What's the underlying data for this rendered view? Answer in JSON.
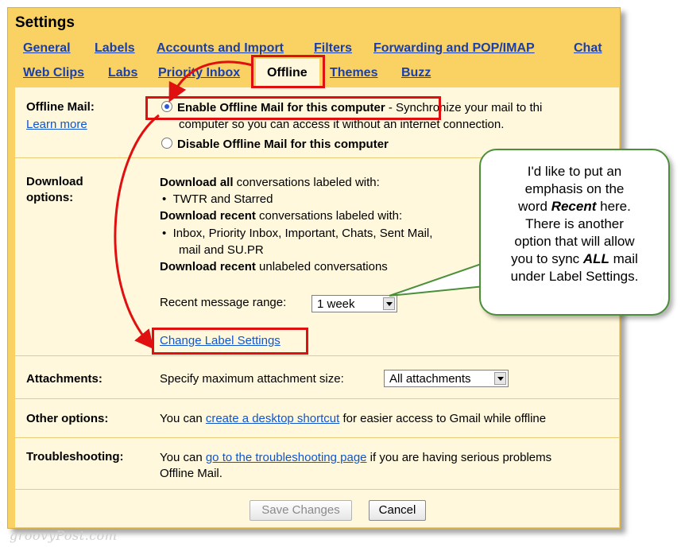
{
  "settings": {
    "title": "Settings",
    "tabs": [
      {
        "label": "General"
      },
      {
        "label": "Labels"
      },
      {
        "label": "Accounts and Import"
      },
      {
        "label": "Filters"
      },
      {
        "label": "Forwarding and POP/IMAP"
      },
      {
        "label": "Chat"
      },
      {
        "label": "Web Clips"
      },
      {
        "label": "Labs"
      },
      {
        "label": "Priority Inbox"
      },
      {
        "label": "Offline"
      },
      {
        "label": "Themes"
      },
      {
        "label": "Buzz"
      }
    ],
    "active_tab": "Offline"
  },
  "offline_mail": {
    "label": "Offline Mail:",
    "learn_more": "Learn more",
    "enable": {
      "label": "Enable Offline Mail for this computer",
      "desc_line1": " - Synchronize your mail to thi",
      "desc_line2": "computer so you can access it without an internet connection."
    },
    "disable_label": "Disable Offline Mail for this computer"
  },
  "download": {
    "label_line1": "Download",
    "label_line2": "options:",
    "all_bold": "Download all",
    "all_rest": " conversations labeled with:",
    "all_bullet": "TWTR and Starred",
    "recent_bold": "Download recent",
    "recent_rest": " conversations labeled with:",
    "recent_bullet_line1": "Inbox, Priority Inbox, Important, Chats, Sent Mail,",
    "recent_bullet_line2": "mail and SU.PR",
    "unlabeled_bold": "Download recent",
    "unlabeled_rest": " unlabeled conversations",
    "range_label": "Recent message range:",
    "range_value": "1 week",
    "change_link": "Change Label Settings"
  },
  "attachments": {
    "label": "Attachments:",
    "text": "Specify maximum attachment size:",
    "value": "All attachments"
  },
  "other": {
    "label": "Other options:",
    "pre": "You can ",
    "link": "create a desktop shortcut",
    "post": " for easier access to Gmail while offline"
  },
  "troubleshooting": {
    "label": "Troubleshooting:",
    "pre": "You can ",
    "link": "go to the troubleshooting page",
    "post": " if you are having serious problems",
    "line2": "Offline Mail."
  },
  "buttons": {
    "save": "Save Changes",
    "cancel": "Cancel"
  },
  "callout": {
    "l1": "I'd like to put an",
    "l2": "emphasis on the",
    "l3_pre": "word ",
    "l3_em": "Recent",
    "l3_post": " here.",
    "l4": "There is another",
    "l5": "option that will allow",
    "l6_pre": "you to sync ",
    "l6_em": "ALL",
    "l6_post": " mail",
    "l7": "under Label Settings."
  },
  "watermark": "groovyPost.com",
  "colors": {
    "header_bg": "#fad163",
    "content_bg": "#fff8dc",
    "link": "#1155cc",
    "annotation_red": "#e01010",
    "callout_border": "#4b8f3a"
  }
}
